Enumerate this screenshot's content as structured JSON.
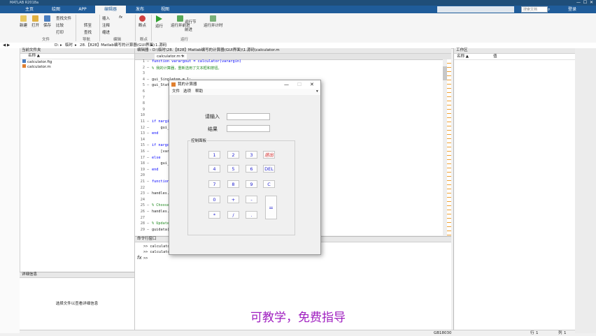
{
  "window": {
    "title": "MATLAB R2018a"
  },
  "tabs": [
    {
      "label": "主页"
    },
    {
      "label": "绘图"
    },
    {
      "label": "APP"
    },
    {
      "label": "编辑器"
    },
    {
      "label": "发布"
    },
    {
      "label": "视图"
    }
  ],
  "search": {
    "placeholder": "搜索文档"
  },
  "login_label": "登录",
  "ribbon": {
    "new_label": "新建",
    "open_label": "打开",
    "save_label": "保存",
    "find_files": "查找文件",
    "compare": "比较",
    "print": "打印",
    "goto": "转至",
    "find": "查找",
    "comment": "注释",
    "indent": "缩进",
    "insert": "插入",
    "fx": "fx",
    "breakpoints": "断点",
    "run": "运行",
    "run_advance": "运行并前进",
    "run_section": "运行节",
    "advance": "前进",
    "run_time": "运行并计时",
    "groups": {
      "file": "文件",
      "navigate": "导航",
      "edit": "编辑",
      "breakpoints": "断点",
      "run": "运行"
    }
  },
  "path": [
    "D:",
    "临时",
    "28.【828】Matlab编写的计算器(GUI界面)",
    "1.源码"
  ],
  "left_panel": {
    "title": "当前文件夹",
    "col_name": "名称 ▲",
    "files": [
      "calculator.fig",
      "calculator.m"
    ],
    "details_title": "详细信息",
    "details_hint": "选择文件以查看详细信息"
  },
  "editor": {
    "title": "编辑器 - D:\\临时\\28.【828】Matlab编写的计算器(GUI界面)\\1.源码\\calculator.m",
    "file_tab": "calculator.m",
    "lines": [
      {
        "n": "1",
        "code": "function varargout = calculator(varargin)",
        "kind": "kw"
      },
      {
        "n": "2",
        "code": "% 我的计算器，重新选用了文本框和按钮。",
        "kind": "cm"
      },
      {
        "n": "3",
        "code": "",
        "kind": ""
      },
      {
        "n": "4",
        "code": "gui_Singleton = 1;",
        "kind": ""
      },
      {
        "n": "5",
        "code": "gui_State = struct('gui_Name',",
        "kind": ""
      },
      {
        "n": "6",
        "code": "",
        "kind": ""
      },
      {
        "n": "7",
        "code": "",
        "kind": ""
      },
      {
        "n": "8",
        "code": "",
        "kind": ""
      },
      {
        "n": "9",
        "code": "",
        "kind": ""
      },
      {
        "n": "10",
        "code": "",
        "kind": ""
      },
      {
        "n": "11",
        "code": "if nargin && ischar(varargin{1})",
        "kind": "kw"
      },
      {
        "n": "12",
        "code": "    gui_State.gui_Callback = str2func",
        "kind": ""
      },
      {
        "n": "13",
        "code": "end",
        "kind": "kw"
      },
      {
        "n": "14",
        "code": "",
        "kind": ""
      },
      {
        "n": "15",
        "code": "if nargout",
        "kind": "kw"
      },
      {
        "n": "16",
        "code": "    [varargout{1:nargout}] = gui_mainfcn",
        "kind": ""
      },
      {
        "n": "17",
        "code": "else",
        "kind": "kw"
      },
      {
        "n": "18",
        "code": "    gui_mainfcn(gui_State, varargin{:});",
        "kind": ""
      },
      {
        "n": "19",
        "code": "end",
        "kind": "kw"
      },
      {
        "n": "20",
        "code": "",
        "kind": ""
      },
      {
        "n": "21",
        "code": "function calculator_OpeningFcn(hObject, eventdata,",
        "kind": "kw"
      },
      {
        "n": "22",
        "code": "",
        "kind": ""
      },
      {
        "n": "23",
        "code": "handles.output = hObject;",
        "kind": ""
      },
      {
        "n": "24",
        "code": "",
        "kind": ""
      },
      {
        "n": "25",
        "code": "% Choose default command line output",
        "kind": "cm"
      },
      {
        "n": "26",
        "code": "handles.output = hObject;",
        "kind": ""
      },
      {
        "n": "27",
        "code": "",
        "kind": ""
      },
      {
        "n": "28",
        "code": "% Update handles structure",
        "kind": "cm"
      },
      {
        "n": "29",
        "code": "guidata(hObject, handles);",
        "kind": ""
      }
    ]
  },
  "command_window": {
    "title": "命令行窗口",
    "history": [
      ">> calculator",
      ">> calculator"
    ],
    "prompt": ">>"
  },
  "workspace": {
    "title": "工作区",
    "col_name": "名称 ▲",
    "col_value": "值"
  },
  "calc": {
    "title": "我的计算器",
    "menu": [
      "文件",
      "选项",
      "帮助"
    ],
    "input_label": "请输入",
    "result_label": "结果",
    "group_title": "控制面板",
    "buttons": [
      {
        "label": "1",
        "row": 0,
        "col": 0,
        "style": ""
      },
      {
        "label": "2",
        "row": 0,
        "col": 1,
        "style": ""
      },
      {
        "label": "3",
        "row": 0,
        "col": 2,
        "style": ""
      },
      {
        "label": "退出",
        "row": 0,
        "col": 3,
        "style": "red"
      },
      {
        "label": "4",
        "row": 1,
        "col": 0,
        "style": ""
      },
      {
        "label": "5",
        "row": 1,
        "col": 1,
        "style": ""
      },
      {
        "label": "6",
        "row": 1,
        "col": 2,
        "style": ""
      },
      {
        "label": "DEL",
        "row": 1,
        "col": 3,
        "style": ""
      },
      {
        "label": "7",
        "row": 2,
        "col": 0,
        "style": ""
      },
      {
        "label": "8",
        "row": 2,
        "col": 1,
        "style": ""
      },
      {
        "label": "9",
        "row": 2,
        "col": 2,
        "style": ""
      },
      {
        "label": "C",
        "row": 2,
        "col": 3,
        "style": ""
      },
      {
        "label": "0",
        "row": 3,
        "col": 0,
        "style": ""
      },
      {
        "label": "+",
        "row": 3,
        "col": 1,
        "style": ""
      },
      {
        "label": "-",
        "row": 3,
        "col": 2,
        "style": ""
      },
      {
        "label": "*",
        "row": 4,
        "col": 0,
        "style": ""
      },
      {
        "label": "/",
        "row": 4,
        "col": 1,
        "style": ""
      },
      {
        "label": ".",
        "row": 4,
        "col": 2,
        "style": ""
      }
    ],
    "equals": "="
  },
  "status": {
    "right": "GB18030",
    "row_label": "行",
    "row_value": "1",
    "col_label": "列",
    "col_value": "1"
  },
  "overlay_caption": "可教学，免费指导",
  "colors": {
    "accent": "#1f5c9a",
    "caption": "#a020c0"
  }
}
